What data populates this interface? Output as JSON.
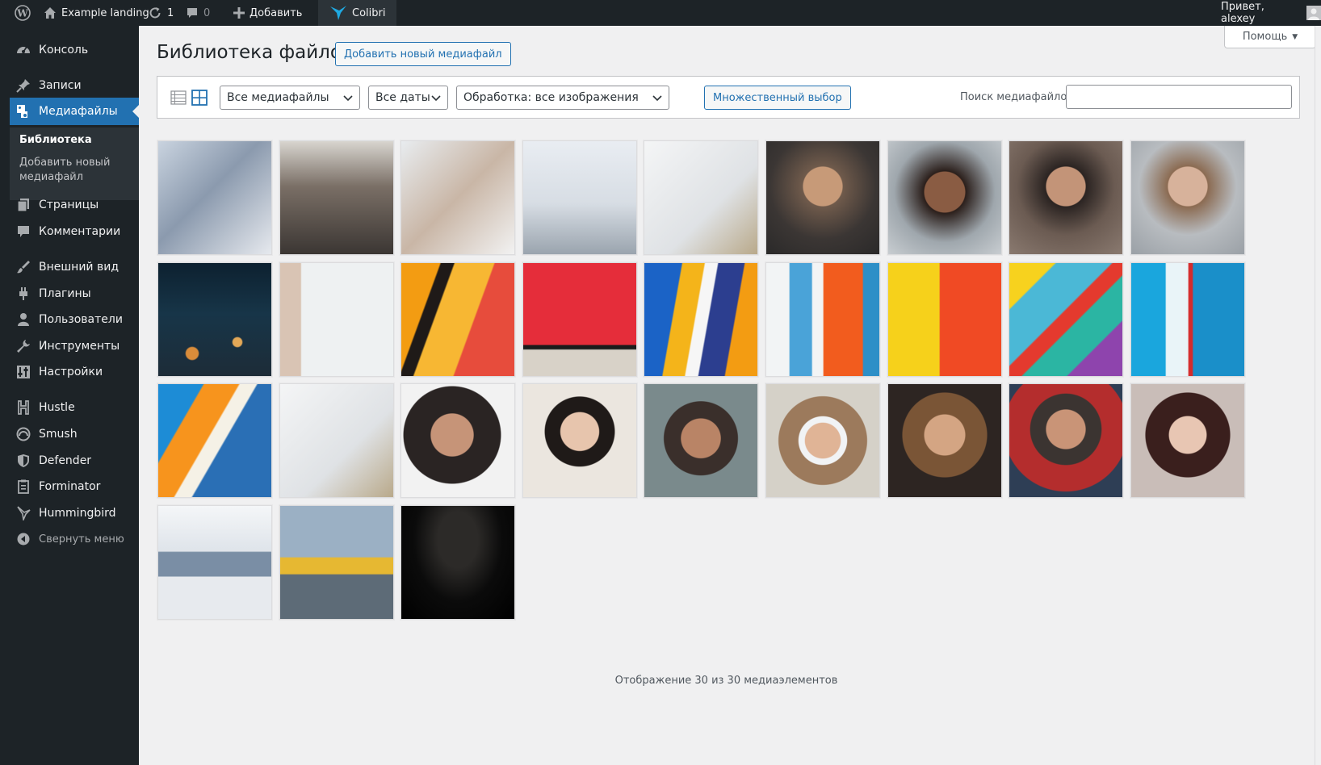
{
  "adminbar": {
    "site_name": "Example landing",
    "updates_count": "1",
    "comments_count": "0",
    "new_label": "Добавить",
    "colibri_label": "Colibri",
    "greeting": "Привет, alexey"
  },
  "sidebar": {
    "items": [
      {
        "label": "Консоль",
        "icon": "dashboard-icon"
      },
      {
        "label": "Записи",
        "icon": "pin-icon"
      },
      {
        "label": "Медиафайлы",
        "icon": "media-icon"
      },
      {
        "label": "Страницы",
        "icon": "page-icon"
      },
      {
        "label": "Комментарии",
        "icon": "comment-icon"
      },
      {
        "label": "Внешний вид",
        "icon": "brush-icon"
      },
      {
        "label": "Плагины",
        "icon": "plugin-icon"
      },
      {
        "label": "Пользователи",
        "icon": "users-icon"
      },
      {
        "label": "Инструменты",
        "icon": "wrench-icon"
      },
      {
        "label": "Настройки",
        "icon": "settings-icon"
      },
      {
        "label": "Hustle",
        "icon": "hustle-icon"
      },
      {
        "label": "Smush",
        "icon": "smush-icon"
      },
      {
        "label": "Defender",
        "icon": "shield-icon"
      },
      {
        "label": "Forminator",
        "icon": "form-icon"
      },
      {
        "label": "Hummingbird",
        "icon": "hummingbird-icon"
      }
    ],
    "submenu": {
      "library": "Библиотека",
      "add_new": "Добавить новый медиафайл"
    },
    "collapse_label": "Свернуть меню"
  },
  "header": {
    "title": "Библиотека файлов",
    "add_new_label": "Добавить новый медиафайл",
    "help_label": "Помощь"
  },
  "toolbar": {
    "type_filter": "Все медиафайлы",
    "date_filter": "Все даты",
    "processing_filter": "Обработка: все изображения",
    "bulk_select_label": "Множественный выбор",
    "search_label": "Поиск медиафайлов",
    "search_value": ""
  },
  "media_items": [
    "woman-window-photo",
    "office-interior-photo",
    "woman-phone-photo",
    "desk-laptop-photo",
    "basket-coffee-photo",
    "bearded-man-photo",
    "smiling-woman-glasses-photo",
    "man-glasses-photo",
    "businesswoman-photo",
    "city-night-photo",
    "hand-white-photo",
    "graffiti-orange-photo",
    "red-abstract-photo",
    "blue-yellow-paint-photo",
    "blue-orange-paint-photo",
    "yellow-red-wall-photo",
    "colorful-mural-photo",
    "blue-red-paint-photo",
    "orange-blue-paint-photo",
    "basket-coffee-photo-2",
    "man-headphones-photo",
    "asian-woman-photo",
    "man-cap-photo",
    "woman-sunglasses-photo",
    "laughing-woman-photo",
    "laughing-man-photo",
    "dark-hair-woman-photo",
    "imac-desk-photo",
    "taxi-street-photo",
    "dark-laptop-photo"
  ],
  "footer": {
    "count_text": "Отображение 30 из 30 медиаэлементов"
  },
  "colors": {
    "accent": "#2271b1",
    "adminbar": "#1d2327",
    "sidebar": "#1d2327",
    "background": "#f0f0f1"
  }
}
